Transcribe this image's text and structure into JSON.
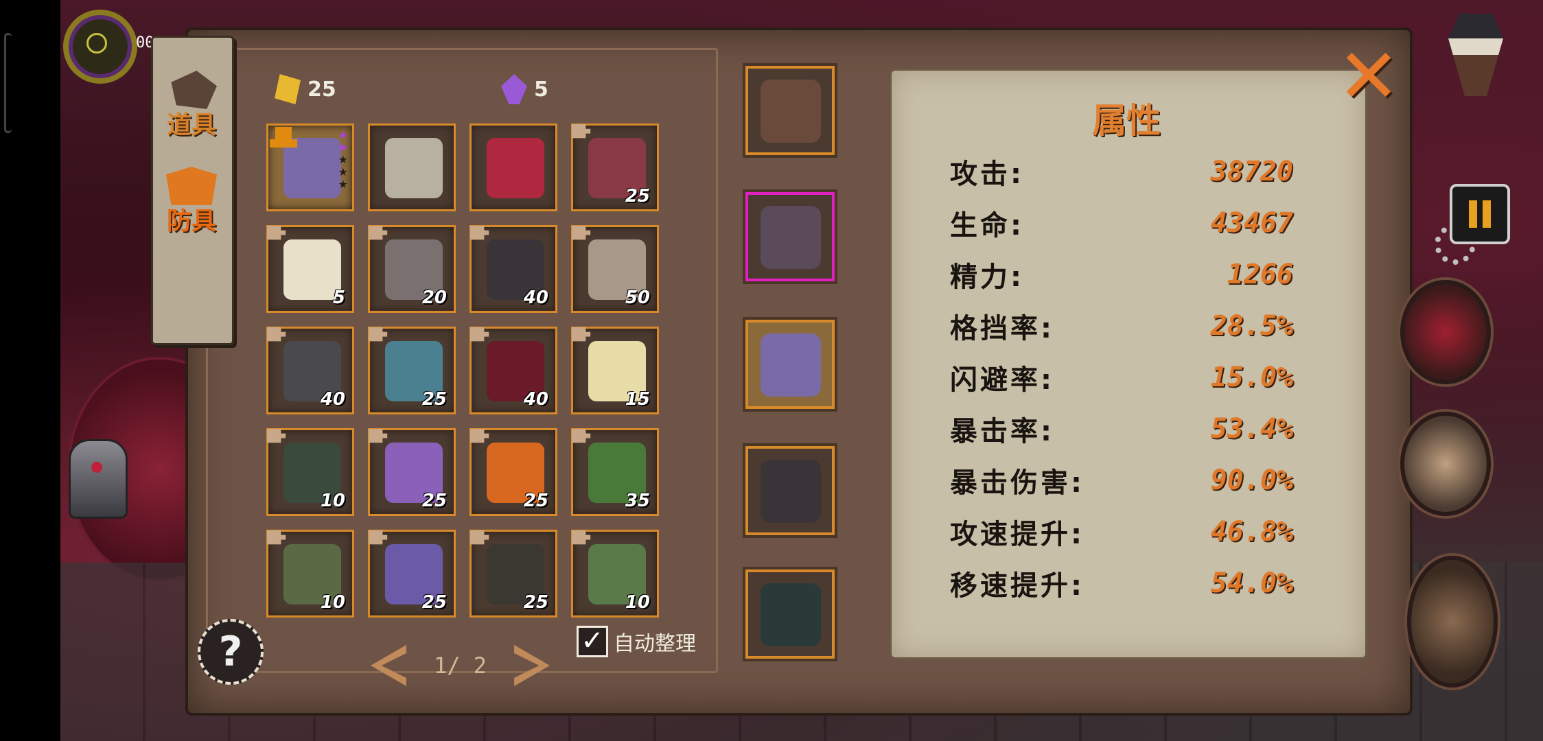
{
  "hud": {
    "counter_text": "00"
  },
  "tabs": [
    {
      "label": "道具",
      "icon": "item-icon",
      "active": false
    },
    {
      "label": "防具",
      "icon": "armor-icon",
      "active": true
    }
  ],
  "currencies": {
    "gold": {
      "icon": "gold-shard-icon",
      "value": "25"
    },
    "crystal": {
      "icon": "purple-crystal-icon",
      "value": "5"
    }
  },
  "inventory": [
    {
      "name": "shadow-claw-armor",
      "count": "",
      "color": "#7a6aa8",
      "stars": 5,
      "stars_lit": 2,
      "selected": true,
      "fragment": false
    },
    {
      "name": "bandaged-robe",
      "count": "",
      "color": "#b8b0a0",
      "fragment": false
    },
    {
      "name": "crimson-boots",
      "count": "",
      "color": "#b02840",
      "fragment": false
    },
    {
      "name": "crimson-vest",
      "count": "25",
      "color": "#8a3a44",
      "fragment": true
    },
    {
      "name": "white-gold-coat",
      "count": "5",
      "color": "#e8e0c8",
      "fragment": true
    },
    {
      "name": "iron-gauntlet",
      "count": "20",
      "color": "#7a7070",
      "fragment": true
    },
    {
      "name": "shadow-jacket",
      "count": "40",
      "color": "#3a3438",
      "fragment": true
    },
    {
      "name": "bone-cape",
      "count": "50",
      "color": "#a89888",
      "fragment": true
    },
    {
      "name": "iron-helm",
      "count": "40",
      "color": "#4a4a4e",
      "fragment": true
    },
    {
      "name": "azure-helm",
      "count": "25",
      "color": "#4a8090",
      "fragment": true
    },
    {
      "name": "crimson-hood",
      "count": "40",
      "color": "#6a1a28",
      "fragment": true
    },
    {
      "name": "golden-crown",
      "count": "15",
      "color": "#e8dca8",
      "fragment": true
    },
    {
      "name": "jade-mask",
      "count": "10",
      "color": "#3a4a3c",
      "fragment": true
    },
    {
      "name": "violet-beast-helm",
      "count": "25",
      "color": "#8a60b8",
      "fragment": true
    },
    {
      "name": "flame-hood",
      "count": "25",
      "color": "#d86820",
      "fragment": true
    },
    {
      "name": "moss-beast-helm",
      "count": "35",
      "color": "#4a7a3a",
      "fragment": true
    },
    {
      "name": "swamp-helm",
      "count": "10",
      "color": "#5a6a44",
      "fragment": true
    },
    {
      "name": "veiled-mask",
      "count": "25",
      "color": "#6a5aa8",
      "fragment": true
    },
    {
      "name": "sigil-helm",
      "count": "25",
      "color": "#3a3830",
      "fragment": true
    },
    {
      "name": "moss-greaves",
      "count": "10",
      "color": "#5a7a4a",
      "fragment": true
    }
  ],
  "pager": {
    "text": "1/ 2"
  },
  "auto_sort": {
    "label": "自动整理",
    "checked": "✓"
  },
  "help": {
    "label": "?"
  },
  "equipped": [
    {
      "name": "blood-scythe",
      "color": "#6a4a3a",
      "kind": "weapon"
    },
    {
      "name": "spirit-pendant",
      "color": "#5a4a5a",
      "kind": "accessory"
    },
    {
      "name": "shadow-claw-armor",
      "color": "#7a6aa8",
      "kind": "helmet"
    },
    {
      "name": "shadow-jacket",
      "color": "#3a3438",
      "kind": "armor"
    },
    {
      "name": "claw-boots",
      "color": "#2a3a38",
      "kind": "boots"
    }
  ],
  "stats": {
    "title": "属性",
    "rows": [
      {
        "label": "攻击:",
        "value": "38720"
      },
      {
        "label": "生命:",
        "value": "43467"
      },
      {
        "label": "精力:",
        "value": "1266"
      },
      {
        "label": "格挡率:",
        "value": "28.5%"
      },
      {
        "label": "闪避率:",
        "value": "15.0%"
      },
      {
        "label": "暴击率:",
        "value": "53.4%"
      },
      {
        "label": "暴击伤害:",
        "value": "90.0%"
      },
      {
        "label": "攻速提升:",
        "value": "46.8%"
      },
      {
        "label": "移速提升:",
        "value": "54.0%"
      }
    ]
  },
  "close": {
    "label": "✕"
  },
  "colors": {
    "accent": "#e0782a",
    "frame": "#d88a2a",
    "accessory": "#e020c0",
    "star": "#b040e0"
  }
}
